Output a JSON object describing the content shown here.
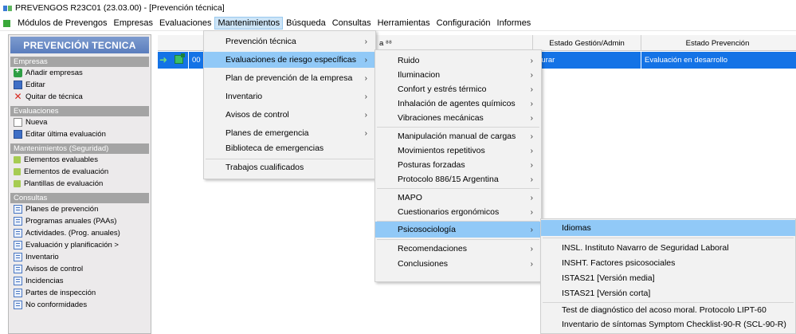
{
  "window": {
    "title": "PREVENGOS R23C01 (23.03.00) - [Prevención técnica]"
  },
  "menubar": {
    "items": [
      "Módulos de Prevengos",
      "Empresas",
      "Evaluaciones",
      "Mantenimientos",
      "Búsqueda",
      "Consultas",
      "Herramientas",
      "Configuración",
      "Informes"
    ],
    "active_index": 3
  },
  "sidebar": {
    "title": "PREVENCIÓN TECNICA",
    "sections": [
      {
        "title": "Empresas",
        "items": [
          {
            "label": "Añadir empresas",
            "icon": "add-company-icon"
          },
          {
            "label": "Editar",
            "icon": "edit-icon"
          },
          {
            "label": "Quitar de técnica",
            "icon": "remove-icon"
          }
        ]
      },
      {
        "title": "Evaluaciones",
        "items": [
          {
            "label": "Nueva",
            "icon": "new-document-icon"
          },
          {
            "label": "Editar última evaluación",
            "icon": "edit-icon"
          }
        ]
      },
      {
        "title": "Mantenimientos (Seguridad)",
        "items": [
          {
            "label": "Elementos evaluables",
            "icon": "leaf-icon"
          },
          {
            "label": "Elementos de evaluación",
            "icon": "leaf-icon"
          },
          {
            "label": "Plantillas de evaluación",
            "icon": "leaf-icon"
          }
        ]
      },
      {
        "title": "Consultas",
        "items": [
          {
            "label": "Planes de prevención",
            "icon": "list-icon"
          },
          {
            "label": "Programas anuales (PAAs)",
            "icon": "list-icon"
          },
          {
            "label": "Actividades. (Prog. anuales)",
            "icon": "list-icon"
          },
          {
            "label": "Evaluación y planificación >",
            "icon": "list-icon"
          },
          {
            "label": "Inventario",
            "icon": "list-icon"
          },
          {
            "label": "Avisos de control",
            "icon": "list-icon"
          },
          {
            "label": "Incidencias",
            "icon": "list-icon"
          },
          {
            "label": "Partes de inspección",
            "icon": "list-icon"
          },
          {
            "label": "No conformidades",
            "icon": "list-icon"
          }
        ]
      }
    ]
  },
  "grid": {
    "header_partial": "a ⁸⁸",
    "col_estado_gestion": "Estado Gestión/Admin",
    "col_estado_prevencion": "Estado Prevención",
    "row": {
      "code": "00",
      "estado_gestion": "cturar",
      "estado_prevencion": "Evaluación en desarrollo"
    }
  },
  "menu_mantenimientos": {
    "items": [
      {
        "label": "Prevención técnica",
        "submenu": true
      },
      {
        "label": "Evaluaciones de riesgo específicas",
        "submenu": true,
        "highlighted": true
      },
      {
        "label": "Plan de prevención de la empresa",
        "submenu": true
      },
      {
        "label": "Inventario",
        "submenu": true
      },
      {
        "label": "Avisos de control",
        "submenu": true
      },
      {
        "label": "Planes de emergencia",
        "submenu": true
      },
      {
        "label": "Biblioteca de emergencias",
        "submenu": false
      },
      {
        "label": "Trabajos cualificados",
        "submenu": false
      }
    ]
  },
  "menu_riesgos_especificos": {
    "items": [
      {
        "label": "Ruido",
        "submenu": true
      },
      {
        "label": "Iluminacion",
        "submenu": true
      },
      {
        "label": "Confort y estrés térmico",
        "submenu": true
      },
      {
        "label": "Inhalación de agentes químicos",
        "submenu": true
      },
      {
        "label": "Vibraciones mecánicas",
        "submenu": true
      },
      {
        "label": "Manipulación manual de cargas",
        "submenu": true
      },
      {
        "label": "Movimientos repetitivos",
        "submenu": true
      },
      {
        "label": "Posturas forzadas",
        "submenu": true
      },
      {
        "label": "Protocolo 886/15 Argentina",
        "submenu": true
      },
      {
        "label": "MAPO",
        "submenu": true
      },
      {
        "label": "Cuestionarios ergonómicos",
        "submenu": true
      },
      {
        "label": "Psicosociología",
        "submenu": true,
        "highlighted": true
      },
      {
        "label": "Recomendaciones",
        "submenu": true
      },
      {
        "label": "Conclusiones",
        "submenu": true
      }
    ]
  },
  "menu_psicosociologia": {
    "items": [
      {
        "label": "Idiomas",
        "highlighted": true
      },
      {
        "label": "INSL. Instituto Navarro de Seguridad Laboral"
      },
      {
        "label": "INSHT. Factores psicosociales"
      },
      {
        "label": "ISTAS21 [Versión media]"
      },
      {
        "label": "ISTAS21 [Versión corta]"
      },
      {
        "label": "Test de diagnóstico del acoso moral. Protocolo LIPT-60"
      },
      {
        "label": "Inventario de síntomas Symptom Checklist-90-R (SCL-90-R)"
      }
    ]
  },
  "colors": {
    "highlight": "#91c9f7",
    "selected_row": "#1473e6",
    "sidebar_header": "#6b8cc7",
    "section_title": "#a4a4a4"
  }
}
